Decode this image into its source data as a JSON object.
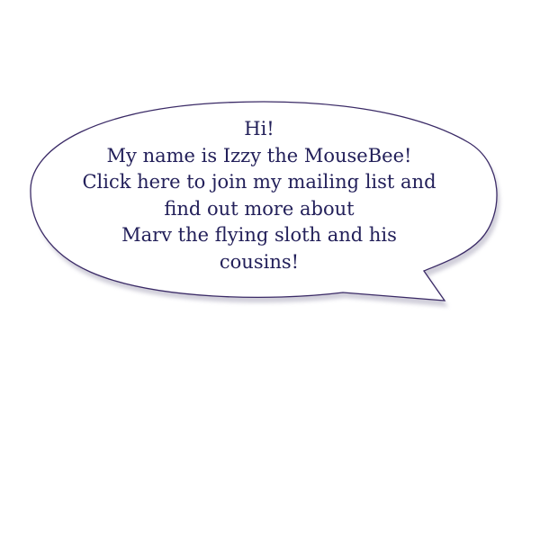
{
  "speech_bubble": {
    "lines": [
      "Hi!",
      "My name is Izzy the MouseBee!",
      "Click here to join my mailing list and",
      "find out more about",
      "Marv the flying sloth and his",
      "cousins!"
    ]
  },
  "colors": {
    "bubble_outline": "#3a2a66",
    "bubble_fill": "#ffffff",
    "text": "#23205a",
    "shadow": "#c9c7d4",
    "background": "#ffffff"
  }
}
